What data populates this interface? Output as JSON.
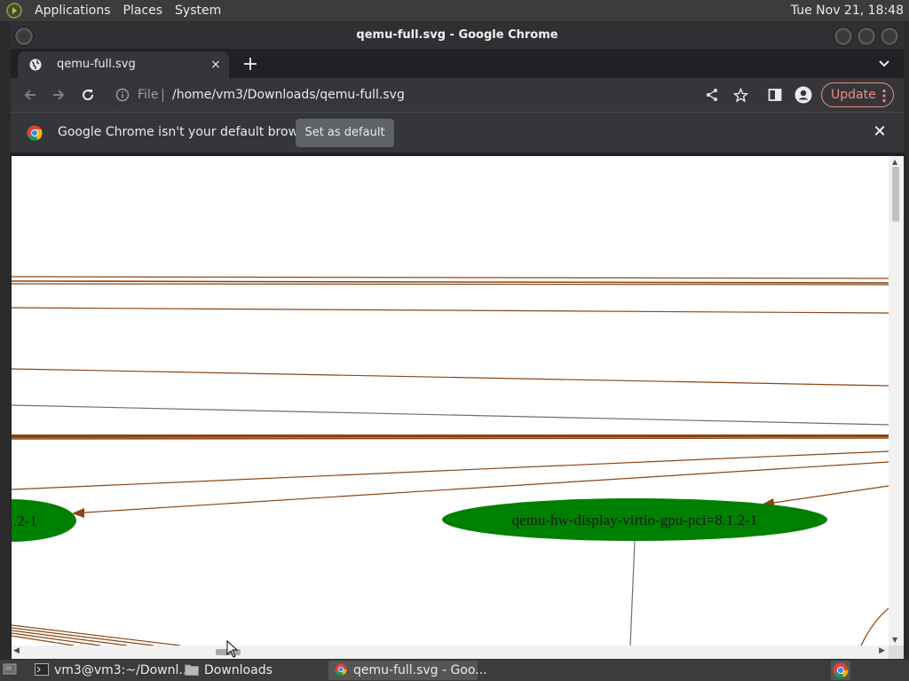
{
  "top_panel": {
    "menus": [
      "Applications",
      "Places",
      "System"
    ],
    "clock": "Tue Nov 21, 18:48"
  },
  "window": {
    "title": "qemu-full.svg - Google Chrome"
  },
  "tab": {
    "label": "qemu-full.svg",
    "close": "×",
    "new_tab": "+"
  },
  "omnibox": {
    "scheme": "File",
    "url": "/home/vm3/Downloads/qemu-full.svg"
  },
  "update_label": "Update",
  "infobar": {
    "message": "Google Chrome isn't your default browser",
    "button": "Set as default",
    "close": "✕"
  },
  "graph": {
    "node_right": "qemu-hw-display-virtio-gpu-pci=8.1.2-1",
    "node_left": ".2-1",
    "node_color": "#008000",
    "edge_color": "#8b4513"
  },
  "taskbar": {
    "tasks": [
      "vm3@vm3:~/Downl...",
      "Downloads",
      "qemu-full.svg - Goo..."
    ]
  },
  "colors": {
    "update_accent": "#f28b82",
    "viewport_bg": "#ffffff"
  }
}
